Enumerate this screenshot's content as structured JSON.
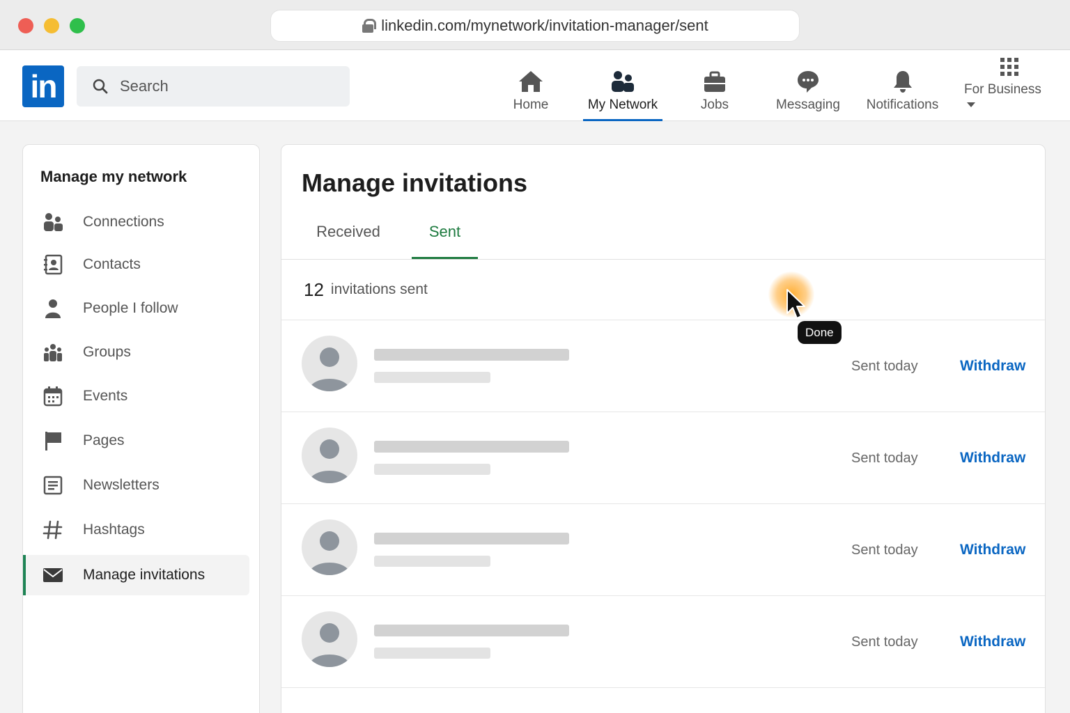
{
  "browser": {
    "url": "linkedin.com/mynetwork/invitation-manager/sent"
  },
  "header": {
    "logo_text": "in",
    "search_placeholder": "Search",
    "nav": [
      {
        "label": "Home",
        "icon": "home-icon"
      },
      {
        "label": "My Network",
        "icon": "people-icon",
        "active": true
      },
      {
        "label": "Jobs",
        "icon": "briefcase-icon"
      },
      {
        "label": "Messaging",
        "icon": "chat-icon"
      },
      {
        "label": "Notifications",
        "icon": "bell-icon"
      },
      {
        "label": "For Business",
        "icon": "grid-icon"
      }
    ]
  },
  "sidebar": {
    "title": "Manage my network",
    "items": [
      {
        "label": "Connections",
        "icon": "connections-icon"
      },
      {
        "label": "Contacts",
        "icon": "contacts-icon"
      },
      {
        "label": "People I follow",
        "icon": "person-icon"
      },
      {
        "label": "Groups",
        "icon": "groups-icon"
      },
      {
        "label": "Events",
        "icon": "calendar-icon"
      },
      {
        "label": "Pages",
        "icon": "flag-icon"
      },
      {
        "label": "Newsletters",
        "icon": "newsletter-icon"
      },
      {
        "label": "Hashtags",
        "icon": "hashtag-icon"
      },
      {
        "label": "Manage invitations",
        "icon": "envelope-icon",
        "active": true
      }
    ]
  },
  "main": {
    "title": "Manage invitations",
    "tabs": [
      {
        "label": "Received"
      },
      {
        "label": "Sent",
        "active": true
      }
    ],
    "count": "12",
    "count_label": "invitations sent",
    "invitations": [
      {
        "status": "Sent today",
        "action": "Withdraw"
      },
      {
        "status": "Sent today",
        "action": "Withdraw"
      },
      {
        "status": "Sent today",
        "action": "Withdraw"
      },
      {
        "status": "Sent today",
        "action": "Withdraw"
      }
    ]
  },
  "cursor": {
    "tooltip": "Done"
  },
  "colors": {
    "brand": "#0a66c2",
    "tab_active": "#1d7a3f",
    "sidebar_active_bar": "#1d8354"
  }
}
